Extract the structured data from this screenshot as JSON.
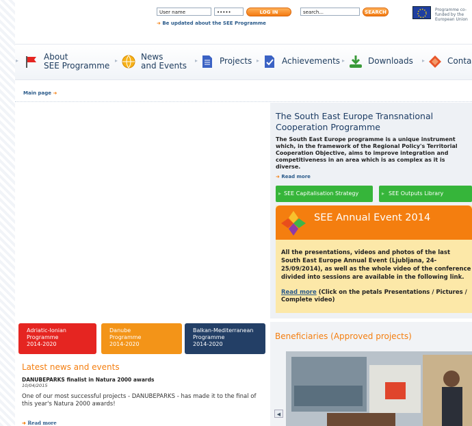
{
  "login": {
    "username_value": "User name",
    "password_value": "•••••",
    "login_button": "LOG IN",
    "search_value": "search...",
    "search_button": "SEARCH",
    "update_link": "Be updated about the SEE Programme"
  },
  "eu_notice": "Programme co-funded by the European Union",
  "nav": {
    "items": [
      {
        "label": "About\nSEE Programme",
        "icon": "flag-icon"
      },
      {
        "label": "News\nand Events",
        "icon": "globe-icon"
      },
      {
        "label": "Projects",
        "icon": "document-icon"
      },
      {
        "label": "Achievements",
        "icon": "checkmark-icon"
      },
      {
        "label": "Downloads",
        "icon": "download-icon"
      },
      {
        "label": "Contac",
        "icon": "contact-icon"
      }
    ]
  },
  "breadcrumb": "Main page",
  "info": {
    "title": "The South East Europe Transnational Cooperation Programme",
    "body": "The South East Europe programme is a unique instrument which, in the framework of the Regional Policy's Territorial Cooperation Objective, aims to improve integration and competitiveness in an area which is as complex as it is diverse.",
    "read_more": "Read more",
    "btn_capitalisation": "SEE Capitalisation Strategy",
    "btn_outputs": "SEE Outputs Library"
  },
  "event": {
    "title": "SEE Annual Event 2014",
    "body": "All the presentations, videos and photos of the last South East Europe Annual Event (Ljubljana, 24-25/09/2014), as well as the whole video of the conference divided into sessions are available in the following link.",
    "link_text": "Read more",
    "link_suffix": " (Click on the petals Presentations / Pictures / Complete video)"
  },
  "programmes": [
    {
      "label": "Adriatic-Ionian\nProgramme\n2014-2020",
      "color": "#e52521"
    },
    {
      "label": "Danube\nProgramme\n2014-2020",
      "color": "#f39418"
    },
    {
      "label": "Balkan-Mediterranean\nProgramme\n2014-2020",
      "color": "#233f66"
    }
  ],
  "news": {
    "section_title": "Latest news and events",
    "headline": "DANUBEPARKS finalist in Natura 2000 awards",
    "date": "10/04/2015",
    "body": "One of our most successful projects - DANUBEPARKS - has made it to the final of this year's Natura 2000 awards!",
    "read_more": "Read more"
  },
  "beneficiaries_title": "Beneficiaries (Approved projects)",
  "colors": {
    "accent_orange": "#f47e0f",
    "green": "#36b53a",
    "navy": "#1b3b63"
  }
}
